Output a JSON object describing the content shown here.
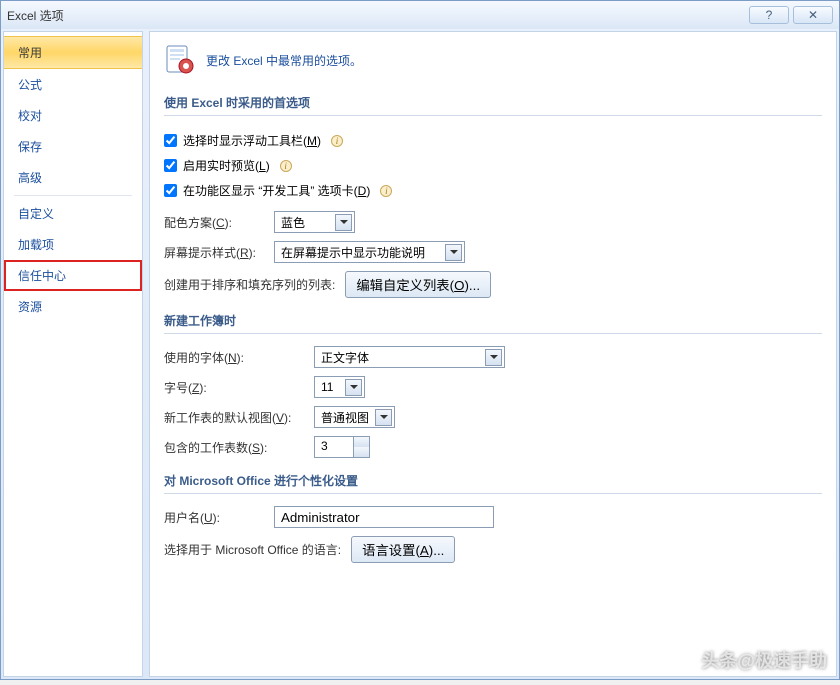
{
  "window": {
    "title": "Excel 选项"
  },
  "sidebar": {
    "items": [
      {
        "label": "常用",
        "selected": true
      },
      {
        "label": "公式"
      },
      {
        "label": "校对"
      },
      {
        "label": "保存"
      },
      {
        "label": "高级"
      },
      {
        "sep": true
      },
      {
        "label": "自定义"
      },
      {
        "label": "加载项"
      },
      {
        "label": "信任中心",
        "highlight": true
      },
      {
        "label": "资源"
      }
    ]
  },
  "header": {
    "subtitle": "更改 Excel 中最常用的选项。"
  },
  "section1": {
    "title": "使用 Excel 时采用的首选项",
    "chk_floating": "选择时显示浮动工具栏(",
    "chk_floating_hot": "M",
    "chk_preview": "启用实时预览(",
    "chk_preview_hot": "L",
    "chk_developer": "在功能区显示 “开发工具” 选项卡(",
    "chk_developer_hot": "D",
    "colorscheme_label": "配色方案(",
    "colorscheme_hot": "C",
    "colorscheme_value": "蓝色",
    "screentip_label": "屏幕提示样式(",
    "screentip_hot": "R",
    "screentip_value": "在屏幕提示中显示功能说明",
    "editlists_label": "创建用于排序和填充序列的列表:",
    "editlists_btn": "编辑自定义列表(",
    "editlists_hot": "O",
    "editlists_btn_tail": ")..."
  },
  "section2": {
    "title": "新建工作簿时",
    "font_label": "使用的字体(",
    "font_hot": "N",
    "font_value": "正文字体",
    "size_label": "字号(",
    "size_hot": "Z",
    "size_value": "11",
    "view_label": "新工作表的默认视图(",
    "view_hot": "V",
    "view_value": "普通视图",
    "sheets_label": "包含的工作表数(",
    "sheets_hot": "S",
    "sheets_value": "3"
  },
  "section3": {
    "title": "对 Microsoft Office 进行个性化设置",
    "user_label": "用户名(",
    "user_hot": "U",
    "user_value": "Administrator",
    "lang_label": "选择用于 Microsoft Office 的语言:",
    "lang_btn": "语言设置(",
    "lang_hot": "A",
    "lang_btn_tail": ")..."
  },
  "watermark": "头条@极速手助",
  "close_paren": ")",
  "colon": "):"
}
